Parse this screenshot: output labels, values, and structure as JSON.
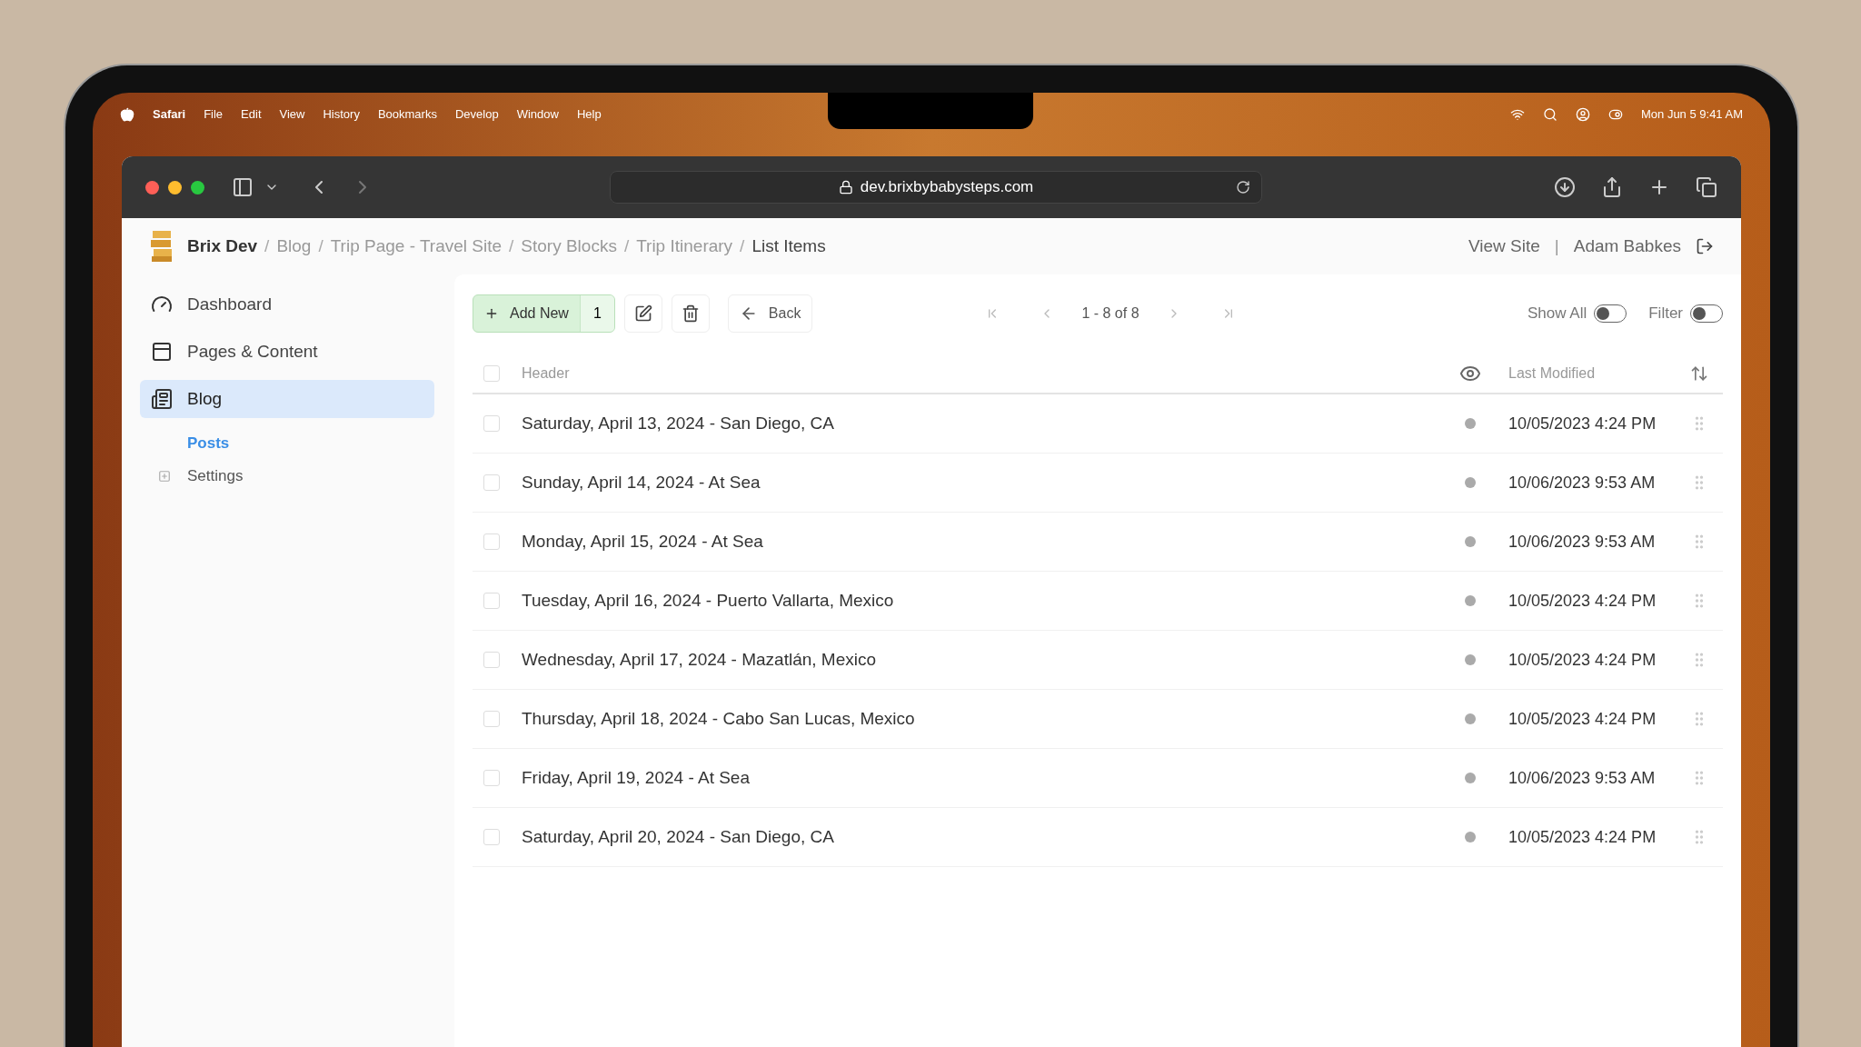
{
  "menu_bar": {
    "app": "Safari",
    "items": [
      "File",
      "Edit",
      "View",
      "History",
      "Bookmarks",
      "Develop",
      "Window",
      "Help"
    ],
    "clock": "Mon Jun 5  9:41 AM"
  },
  "browser": {
    "url": "dev.brixbybabysteps.com"
  },
  "breadcrumb": [
    "Brix Dev",
    "Blog",
    "Trip Page - Travel Site",
    "Story Blocks",
    "Trip Itinerary",
    "List Items"
  ],
  "breadcrumb_separator": "/",
  "header_links": [
    "View Site",
    "Adam Babkes"
  ],
  "header_separator": "|",
  "sidebar": {
    "items": [
      {
        "kind": "dashboard",
        "label": "Dashboard",
        "selected": false
      },
      {
        "kind": "pages",
        "label": "Pages & Content",
        "selected": false
      },
      {
        "kind": "blog",
        "label": "Blog",
        "selected": true,
        "children": [
          {
            "label": "Posts",
            "selected": true
          },
          {
            "label": "Settings",
            "selected": false,
            "expanded": false
          }
        ]
      }
    ]
  },
  "toolbar": {
    "add_label": "Add New",
    "add_count": "1",
    "back_label": "Back",
    "pagination": "1 - 8 of 8",
    "toggles": [
      {
        "label": "Show All",
        "on": false
      },
      {
        "label": "Filter",
        "on": false
      }
    ]
  },
  "table": {
    "columns": [
      "Header",
      "Last Modified"
    ],
    "all_checked": false,
    "rows": [
      {
        "header": "Saturday, April 13, 2024 - San Diego, CA",
        "modified": "10/05/2023 4:24 PM",
        "checked": false
      },
      {
        "header": "Sunday, April 14, 2024 - At Sea",
        "modified": "10/06/2023 9:53 AM",
        "checked": false
      },
      {
        "header": "Monday, April 15, 2024 - At Sea",
        "modified": "10/06/2023 9:53 AM",
        "checked": false
      },
      {
        "header": "Tuesday, April 16, 2024 - Puerto Vallarta, Mexico",
        "modified": "10/05/2023 4:24 PM",
        "checked": false
      },
      {
        "header": "Wednesday, April 17, 2024 - Mazatlán, Mexico",
        "modified": "10/05/2023 4:24 PM",
        "checked": false
      },
      {
        "header": "Thursday, April 18, 2024 - Cabo San Lucas, Mexico",
        "modified": "10/05/2023 4:24 PM",
        "checked": false
      },
      {
        "header": "Friday, April 19, 2024 - At Sea",
        "modified": "10/06/2023 9:53 AM",
        "checked": false
      },
      {
        "header": "Saturday, April 20, 2024 - San Diego, CA",
        "modified": "10/05/2023 4:24 PM",
        "checked": false
      }
    ]
  }
}
